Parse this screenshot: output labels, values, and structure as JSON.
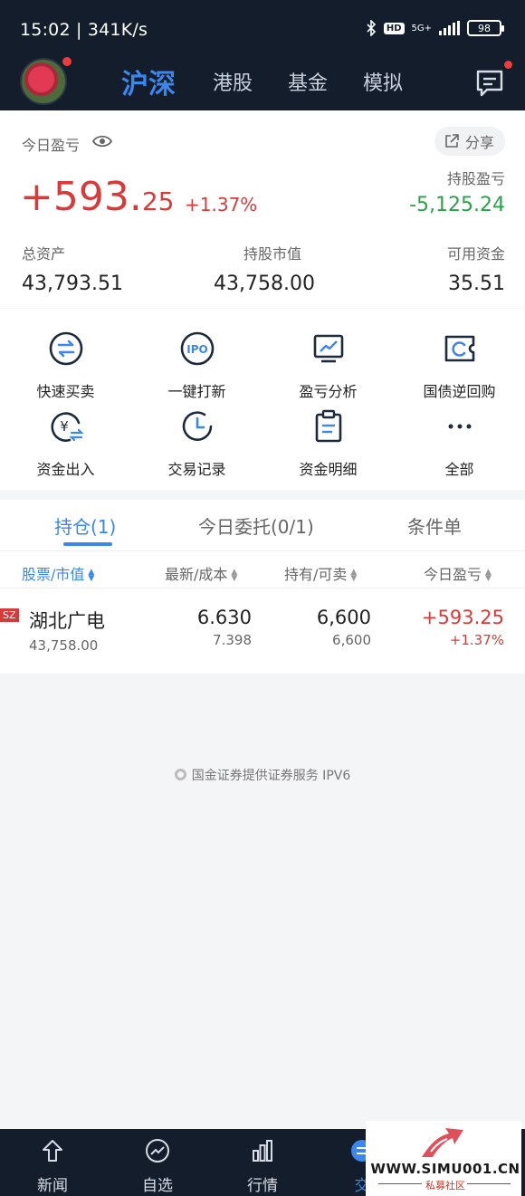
{
  "status": {
    "time_speed": "15:02 | 341K/s",
    "network": "5G+",
    "hd": "HD",
    "battery": "98"
  },
  "header": {
    "tabs": [
      "沪深",
      "港股",
      "基金",
      "模拟"
    ],
    "active_tab": "沪深"
  },
  "summary": {
    "today_label": "今日盈亏",
    "share_label": "分享",
    "today_pl_int": "+593.",
    "today_pl_dec": "25",
    "today_pct": "+1.37%",
    "hold_pl_label": "持股盈亏",
    "hold_pl_value": "-5,125.24",
    "total_assets_label": "总资产",
    "total_assets": "43,793.51",
    "market_value_label": "持股市值",
    "market_value": "43,758.00",
    "available_label": "可用资金",
    "available": "35.51"
  },
  "actions": [
    {
      "label": "快速买卖",
      "icon": "swap-icon"
    },
    {
      "label": "一键打新",
      "icon": "ipo-icon"
    },
    {
      "label": "盈亏分析",
      "icon": "chart-monitor-icon"
    },
    {
      "label": "国债逆回购",
      "icon": "ticket-cycle-icon"
    },
    {
      "label": "资金出入",
      "icon": "yuan-transfer-icon"
    },
    {
      "label": "交易记录",
      "icon": "clock-icon"
    },
    {
      "label": "资金明细",
      "icon": "clipboard-icon"
    },
    {
      "label": "全部",
      "icon": "more-icon"
    }
  ],
  "positions": {
    "tabs": [
      "持仓(1)",
      "今日委托(0/1)",
      "条件单"
    ],
    "headers": [
      "股票/市值",
      "最新/成本",
      "持有/可卖",
      "今日盈亏"
    ],
    "rows": [
      {
        "market": "SZ",
        "name": "湖北广电",
        "market_value": "43,758.00",
        "latest": "6.630",
        "cost": "7.398",
        "holding": "6,600",
        "sellable": "6,600",
        "today_pl": "+593.25",
        "today_pct": "+1.37%"
      }
    ]
  },
  "footer_note": "国金证券提供证券服务 IPV6",
  "bottom_nav": [
    "新闻",
    "自选",
    "行情",
    "交"
  ],
  "watermark": {
    "site": "WWW.SIMU001.CN",
    "sub": "私募社区"
  },
  "colors": {
    "up": "#d83a3a",
    "down": "#2aa14a",
    "accent": "#3b87ee",
    "dark": "#131d2b"
  }
}
